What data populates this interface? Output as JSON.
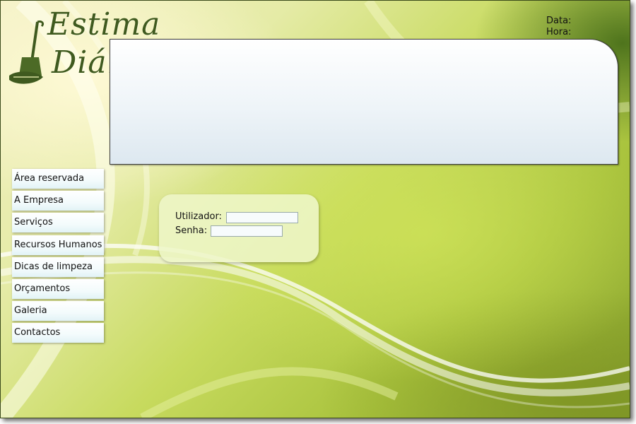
{
  "logo": {
    "line1": "Estima",
    "line2": "Diária"
  },
  "header": {
    "date_label": "Data:",
    "time_label": "Hora:"
  },
  "nav": {
    "items": [
      {
        "label": "Área reservada"
      },
      {
        "label": "A Empresa"
      },
      {
        "label": "Serviços"
      },
      {
        "label": "Recursos Humanos"
      },
      {
        "label": "Dicas de limpeza"
      },
      {
        "label": "Orçamentos"
      },
      {
        "label": "Galeria"
      },
      {
        "label": "Contactos"
      }
    ]
  },
  "login": {
    "user_label": "Utilizador:",
    "user_value": "",
    "pass_label": "Senha:",
    "pass_value": ""
  },
  "colors": {
    "logo": "#3f5a1f",
    "background_primary": "#c7da5e"
  }
}
